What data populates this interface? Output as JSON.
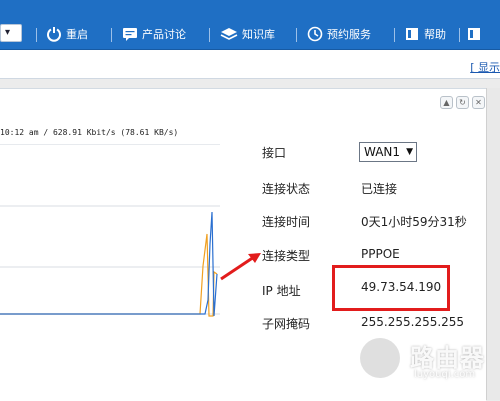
{
  "nav": {
    "dropdown_glyph": "▾",
    "items": [
      {
        "label": "重启",
        "icon": "power-icon"
      },
      {
        "label": "产品讨论",
        "icon": "chat-icon"
      },
      {
        "label": "知识库",
        "icon": "layers-icon"
      },
      {
        "label": "预约服务",
        "icon": "clock-icon"
      },
      {
        "label": "帮助",
        "icon": "book-icon"
      }
    ],
    "separator": "|"
  },
  "subbar": {
    "show_link": "[ 显示"
  },
  "traffic": {
    "stats_text": "10:12 am / 628.91 Kbit/s (78.61 KB/s)"
  },
  "connection": {
    "interface_label": "接口",
    "interface_value": "WAN1",
    "status_label": "连接状态",
    "status_value": "已连接",
    "time_label": "连接时间",
    "time_value": "0天1小时59分31秒",
    "type_label": "连接类型",
    "type_value": "PPPOE",
    "ip_label": "IP 地址",
    "ip_value": "49.73.54.190",
    "mask_label": "子网掩码",
    "mask_value": "255.255.255.255"
  },
  "watermark": {
    "text": "路由器",
    "subtext": "luyouqi.com"
  },
  "colors": {
    "nav_bg": "#1f6fc4",
    "highlight": "#e21c1c",
    "line_orange": "#f0a020",
    "line_blue": "#2a6fd0"
  }
}
